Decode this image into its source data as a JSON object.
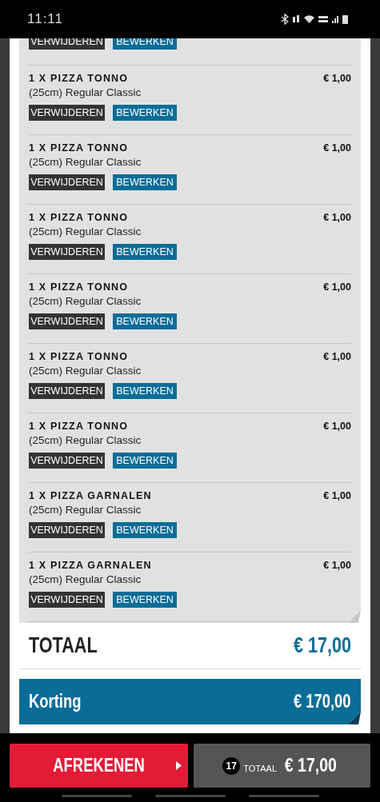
{
  "status_bar": {
    "time": "11:11"
  },
  "partial_item": {
    "remove_label": "VERWIJDEREN",
    "edit_label": "BEWERKEN"
  },
  "items": [
    {
      "title": "1 X PIZZA TONNO",
      "price": "€ 1,00",
      "details": "(25cm) Regular Classic",
      "remove_label": "VERWIJDEREN",
      "edit_label": "BEWERKEN"
    },
    {
      "title": "1 X PIZZA TONNO",
      "price": "€ 1,00",
      "details": "(25cm) Regular Classic",
      "remove_label": "VERWIJDEREN",
      "edit_label": "BEWERKEN"
    },
    {
      "title": "1 X PIZZA TONNO",
      "price": "€ 1,00",
      "details": "(25cm) Regular Classic",
      "remove_label": "VERWIJDEREN",
      "edit_label": "BEWERKEN"
    },
    {
      "title": "1 X PIZZA TONNO",
      "price": "€ 1,00",
      "details": "(25cm) Regular Classic",
      "remove_label": "VERWIJDEREN",
      "edit_label": "BEWERKEN"
    },
    {
      "title": "1 X PIZZA TONNO",
      "price": "€ 1,00",
      "details": "(25cm) Regular Classic",
      "remove_label": "VERWIJDEREN",
      "edit_label": "BEWERKEN"
    },
    {
      "title": "1 X PIZZA TONNO",
      "price": "€ 1,00",
      "details": "(25cm) Regular Classic",
      "remove_label": "VERWIJDEREN",
      "edit_label": "BEWERKEN"
    },
    {
      "title": "1 X PIZZA GARNALEN",
      "price": "€ 1,00",
      "details": "(25cm) Regular Classic",
      "remove_label": "VERWIJDEREN",
      "edit_label": "BEWERKEN"
    },
    {
      "title": "1 X PIZZA GARNALEN",
      "price": "€ 1,00",
      "details": "(25cm) Regular Classic",
      "remove_label": "VERWIJDEREN",
      "edit_label": "BEWERKEN"
    }
  ],
  "total": {
    "label": "TOTAAL",
    "amount": "€ 17,00"
  },
  "discount": {
    "label": "Korting",
    "amount": "€ 170,00"
  },
  "bottom_bar": {
    "checkout_label": "AFREKENEN",
    "count": "17",
    "total_label": "TOTAAL",
    "total_amount": "€ 17,00"
  }
}
